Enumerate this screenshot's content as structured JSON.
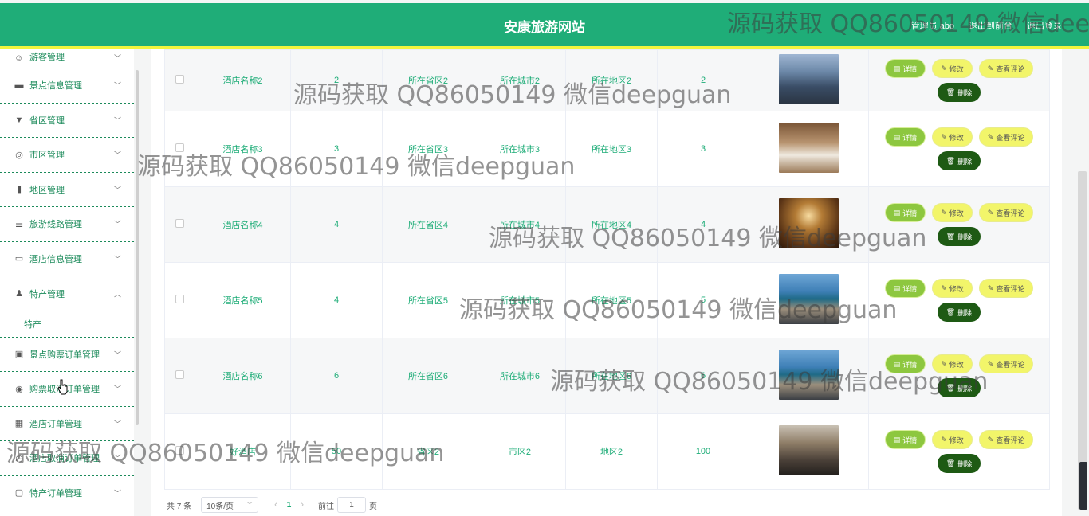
{
  "header": {
    "title": "安康旅游网站",
    "user": "管理员 abo",
    "back_front": "退出到前台",
    "logout": "退出登录"
  },
  "sidebar": {
    "items": [
      {
        "icon": "user-icon",
        "label": "游客管理",
        "expanded": false
      },
      {
        "icon": "ticket-icon",
        "label": "景点信息管理",
        "expanded": false
      },
      {
        "icon": "pin-icon",
        "label": "省区管理",
        "expanded": false
      },
      {
        "icon": "globe-icon",
        "label": "市区管理",
        "expanded": false
      },
      {
        "icon": "bar-chart-icon",
        "label": "地区管理",
        "expanded": false
      },
      {
        "icon": "list-icon",
        "label": "旅游线路管理",
        "expanded": false
      },
      {
        "icon": "monitor-icon",
        "label": "酒店信息管理",
        "expanded": false
      },
      {
        "icon": "person-icon",
        "label": "特产管理",
        "expanded": true
      },
      {
        "icon": "bag-icon",
        "label": "景点购票订单管理",
        "expanded": false
      },
      {
        "icon": "compass-icon",
        "label": "购票取消订单管理",
        "expanded": false
      },
      {
        "icon": "grid-icon",
        "label": "酒店订单管理",
        "expanded": false
      },
      {
        "icon": "clock-icon",
        "label": "酒店取消订单管理",
        "expanded": false
      },
      {
        "icon": "chat-icon",
        "label": "特产订单管理",
        "expanded": false
      }
    ],
    "sub_item": "特产"
  },
  "table": {
    "rows": [
      {
        "name": "酒店名称2",
        "c2": "2",
        "province": "所在省区2",
        "city": "所在城市2",
        "area": "所在地区2",
        "num": "2",
        "img": "hotel-exterior"
      },
      {
        "name": "酒店名称3",
        "c2": "3",
        "province": "所在省区3",
        "city": "所在城市3",
        "area": "所在地区3",
        "num": "3",
        "img": "hotel-room"
      },
      {
        "name": "酒店名称4",
        "c2": "4",
        "province": "所在省区4",
        "city": "所在城市4",
        "area": "所在地区4",
        "num": "4",
        "img": "hotel-lobby"
      },
      {
        "name": "酒店名称5",
        "c2": "4",
        "province": "所在省区5",
        "city": "所在城市5",
        "area": "所在地区5",
        "num": "5",
        "img": "hotel-sea"
      },
      {
        "name": "酒店名称6",
        "c2": "6",
        "province": "所在省区6",
        "city": "所在城市6",
        "area": "所在地区6",
        "num": "6",
        "img": "hotel-sea"
      },
      {
        "name": "好酒店",
        "c2": "50",
        "province": "省区2",
        "city": "市区2",
        "area": "地区2",
        "num": "100",
        "img": "hotel-hall"
      }
    ],
    "actions": {
      "detail": "详情",
      "edit": "修改",
      "comment": "查看评论",
      "delete": "删除"
    }
  },
  "pagination": {
    "total": "共 7 条",
    "page_size": "10条/页",
    "current": "1",
    "goto_prefix": "前往",
    "goto_value": "1",
    "goto_suffix": "页"
  },
  "watermarks": [
    "源码获取 QQ86050149 微信deepguan",
    "源码获取 QQ86050149 微信deepguan",
    "源码获取 QQ86050149 微信deepguan",
    "源码获取 QQ86050149 微信deepguan",
    "源码获取 QQ86050149 微信deepguan",
    "源码获取 QQ86050149 微信deepguan",
    "源码获取 QQ86050149 微信deepguan"
  ],
  "colors": {
    "primary": "#1fad78",
    "accent": "#f2f53d",
    "delete": "#1e5a14",
    "detail": "#8dc73f"
  }
}
